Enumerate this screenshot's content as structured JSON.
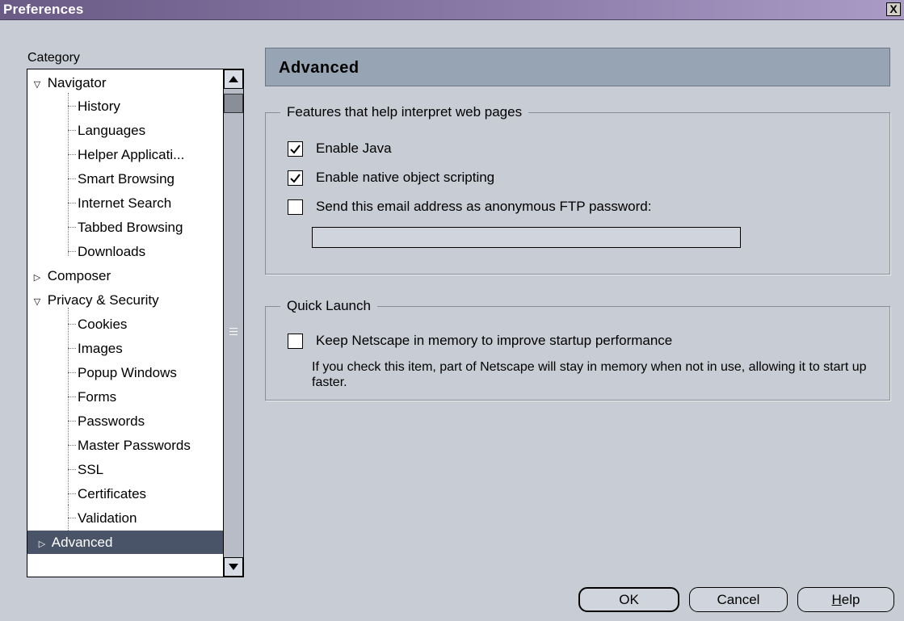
{
  "window": {
    "title": "Preferences",
    "close_glyph": "X"
  },
  "sidebar": {
    "label": "Category",
    "items": [
      {
        "label": "Navigator",
        "twisty": "▽"
      },
      {
        "label": "History"
      },
      {
        "label": "Languages"
      },
      {
        "label": "Helper Applicati..."
      },
      {
        "label": "Smart Browsing"
      },
      {
        "label": "Internet Search"
      },
      {
        "label": "Tabbed Browsing"
      },
      {
        "label": "Downloads"
      },
      {
        "label": "Composer",
        "twisty": "▷"
      },
      {
        "label": "Privacy & Security",
        "twisty": "▽"
      },
      {
        "label": "Cookies"
      },
      {
        "label": "Images"
      },
      {
        "label": "Popup Windows"
      },
      {
        "label": "Forms"
      },
      {
        "label": "Passwords"
      },
      {
        "label": "Master Passwords"
      },
      {
        "label": "SSL"
      },
      {
        "label": "Certificates"
      },
      {
        "label": "Validation"
      },
      {
        "label": "Advanced",
        "twisty": "▷",
        "selected": true
      }
    ]
  },
  "panel": {
    "title": "Advanced",
    "features": {
      "legend": "Features that help interpret web pages",
      "enable_java": {
        "label": "Enable Java",
        "checked": true
      },
      "native_scripting": {
        "label": "Enable native object scripting",
        "checked": true
      },
      "ftp_password": {
        "label": "Send this email address as anonymous FTP password:",
        "checked": false
      },
      "email_value": ""
    },
    "quick_launch": {
      "legend": "Quick Launch",
      "keep_in_memory": {
        "label": "Keep Netscape in memory to improve startup performance",
        "checked": false
      },
      "description": "If you check this item, part of Netscape will stay in memory when not in use, allowing it to start up faster."
    }
  },
  "buttons": {
    "ok": "OK",
    "cancel": "Cancel",
    "help_mnemonic": "H",
    "help_rest": "elp"
  },
  "colors": {
    "selected_row": "#4a5468",
    "header_bar": "#96a4b4",
    "window_bg": "#c8ccd4"
  }
}
